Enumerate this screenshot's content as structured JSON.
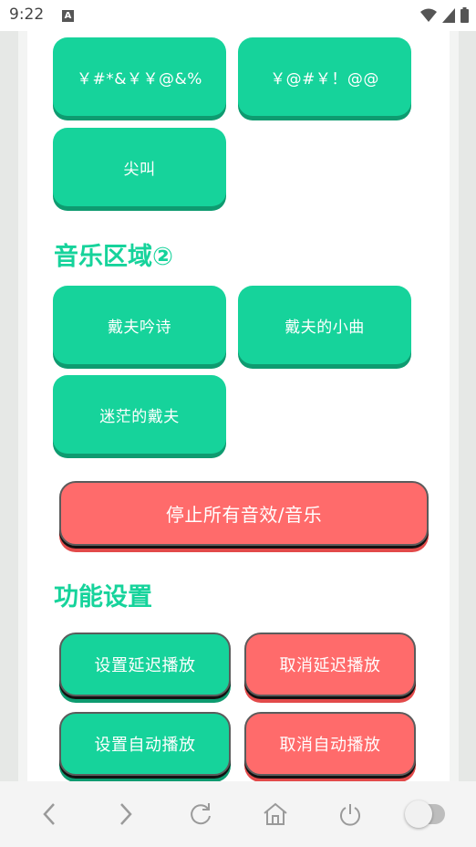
{
  "status_bar": {
    "time": "9:22",
    "notification_letter": "A"
  },
  "sound_buttons": {
    "btn1": "￥#*&￥￥@&%",
    "btn2": "￥@#￥！@@",
    "btn3": "尖叫"
  },
  "music_section": {
    "title": "音乐区域②",
    "buttons": [
      "戴夫吟诗",
      "戴夫的小曲",
      "迷茫的戴夫"
    ]
  },
  "stop_button": "停止所有音效/音乐",
  "settings_section": {
    "title": "功能设置",
    "set_delay": "设置延迟播放",
    "cancel_delay": "取消延迟播放",
    "set_auto": "设置自动播放",
    "cancel_auto": "取消自动播放"
  },
  "colors": {
    "green": "#16d39b",
    "red": "#ff6b6b"
  },
  "navbar_icons": [
    "back-icon",
    "forward-icon",
    "refresh-icon",
    "home-icon",
    "power-icon",
    "toggle-switch"
  ]
}
